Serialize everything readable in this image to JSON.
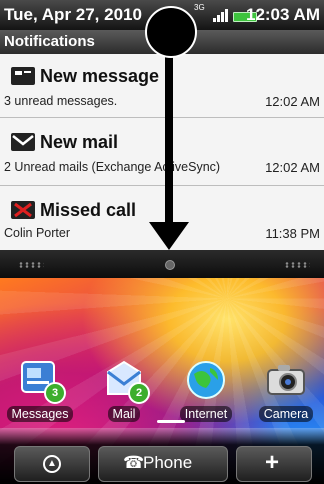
{
  "status_bar": {
    "date": "Tue, Apr 27, 2010",
    "time": "12:03 AM",
    "network": "3G"
  },
  "notifications": {
    "header": "Notifications",
    "items": [
      {
        "icon": "message-icon",
        "title": "New message",
        "subtitle": "3 unread messages.",
        "time": "12:02 AM"
      },
      {
        "icon": "mail-icon",
        "title": "New mail",
        "subtitle": "2 Unread mails (Exchange ActiveSync)",
        "time": "12:02 AM"
      },
      {
        "icon": "missed-call-icon",
        "title": "Missed call",
        "subtitle": "Colin Porter",
        "time": "11:38 PM"
      }
    ]
  },
  "home": {
    "apps": [
      {
        "label": "Messages",
        "badge": "3",
        "icon": "messages-icon"
      },
      {
        "label": "Mail",
        "badge": "2",
        "icon": "mail-app-icon"
      },
      {
        "label": "Internet",
        "icon": "globe-icon"
      },
      {
        "label": "Camera",
        "icon": "camera-icon"
      }
    ],
    "dock": {
      "phone_label": "Phone",
      "left_icon": "up-arrow-icon",
      "right_icon": "plus-icon"
    }
  },
  "colors": {
    "badge_green": "#3cae2c",
    "battery_green": "#3ec43e"
  }
}
